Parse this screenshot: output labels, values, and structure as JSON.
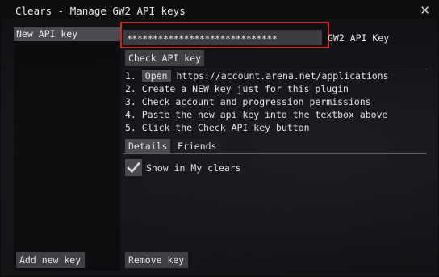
{
  "window": {
    "title": "Clears - Manage GW2 API keys",
    "close_glyph": "✕"
  },
  "sidebar": {
    "items": [
      {
        "label": "New API key",
        "selected": true
      }
    ],
    "add_button_label": "Add new key"
  },
  "api_key": {
    "value": "*****************************",
    "label": "GW2 API Key",
    "highlight_color": "#d81e1e"
  },
  "check_button_label": "Check API key",
  "instructions": {
    "steps": [
      {
        "number": "1.",
        "button": "Open",
        "text": "https://account.arena.net/applications"
      },
      {
        "number": "2.",
        "text": "Create a NEW key just for this plugin"
      },
      {
        "number": "3.",
        "text": "Check account and progression permissions"
      },
      {
        "number": "4.",
        "text": "Paste the new api key into the textbox above"
      },
      {
        "number": "5.",
        "text": "Click the Check API key button"
      }
    ]
  },
  "tabs": [
    {
      "label": "Details",
      "active": true
    },
    {
      "label": "Friends",
      "active": false
    }
  ],
  "details": {
    "show_in_my_clears_label": "Show in My clears",
    "show_in_my_clears_checked": true
  },
  "remove_button_label": "Remove key",
  "colors": {
    "button_bg": "#3f4044",
    "selected_bg": "#4a4b4f",
    "text": "#e6e6e6"
  }
}
